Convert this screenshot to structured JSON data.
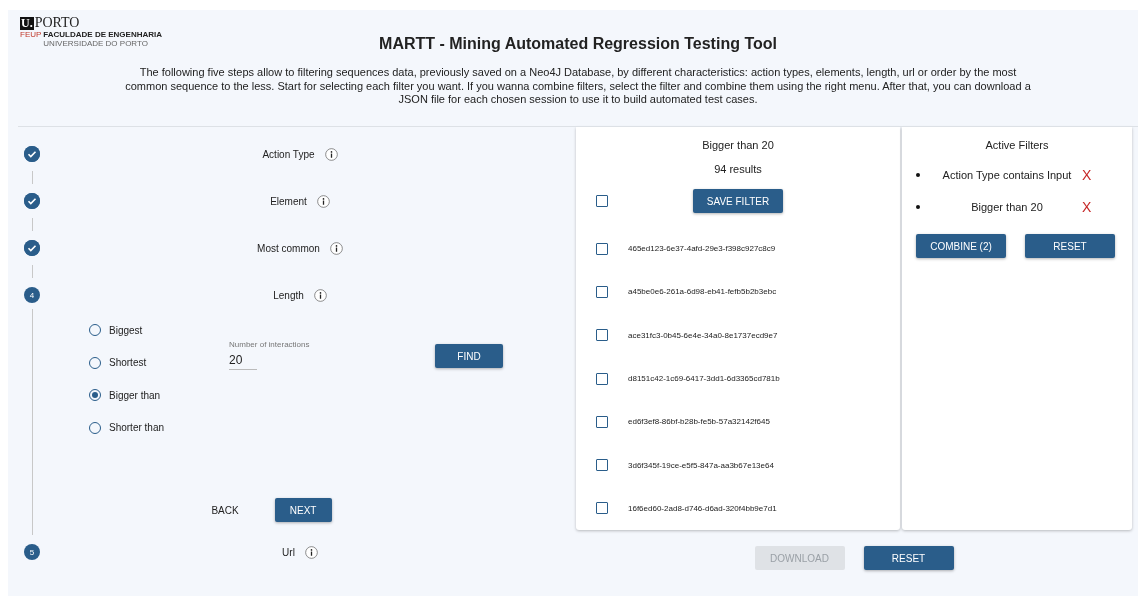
{
  "logo": {
    "mark": "U.",
    "name": "PORTO",
    "school": "FEUP",
    "line_1": "FACULDADE DE ENGENHARIA",
    "line_2": "UNIVERSIDADE DO PORTO"
  },
  "title": "MARTT - Mining Automated Regression Testing Tool",
  "description": "The following five steps allow to filtering sequences data, previously saved on a Neo4J Database, by different characteristics: action types, elements, length, url or order by the most common sequence to the less. Start for selecting each filter you want. If you wanna combine filters, select the filter and combine them using the right menu. After that, you can download a JSON file for each chosen session to use it to build automated test cases.",
  "steps": [
    {
      "label": "Action Type",
      "kind": "done",
      "expanded": false
    },
    {
      "label": "Element",
      "kind": "done",
      "expanded": false
    },
    {
      "label": "Most common",
      "kind": "done",
      "expanded": false
    },
    {
      "label": "Length",
      "kind": "current",
      "number": "4",
      "expanded": true
    },
    {
      "label": "Url",
      "kind": "current",
      "number": "5"
    }
  ],
  "length_step": {
    "options": [
      {
        "label": "Biggest",
        "selected": false
      },
      {
        "label": "Shortest",
        "selected": false
      },
      {
        "label": "Bigger than",
        "selected": true
      },
      {
        "label": "Shorter than",
        "selected": false
      }
    ],
    "field": {
      "label": "Number of interactions",
      "value": "20"
    },
    "find_button": "FIND",
    "back_button": "BACK",
    "next_button": "NEXT"
  },
  "results": {
    "title": "Bigger than 20",
    "count": "94 results",
    "select_all": {
      "checked": false
    },
    "save_button": "SAVE FILTER",
    "sessions": [
      {
        "id": "465ed123-6e37-4afd-29e3-f398c927c8c9",
        "checked": false
      },
      {
        "id": "a45be0e6-261a-6d98-eb41-fefb5b2b3ebc",
        "checked": false
      },
      {
        "id": "ace31fc3-0b45-6e4e-34a0-8e1737ecd9e7",
        "checked": false
      },
      {
        "id": "d8151c42-1c69-6417-3dd1-6d3365cd781b",
        "checked": false
      },
      {
        "id": "ed6f3ef8-86bf-b28b-fe5b-57a32142f645",
        "checked": false
      },
      {
        "id": "3d6f345f-19ce-e5f5-847a-aa3b67e13e64",
        "checked": false
      },
      {
        "id": "16f6ed60-2ad8-d746-d6ad-320f4bb9e7d1",
        "checked": false
      }
    ]
  },
  "active_filters": {
    "title": "Active Filters",
    "filters": [
      {
        "label": "Action Type contains Input",
        "remove": "X"
      },
      {
        "label": "Bigger than 20",
        "remove": "X"
      }
    ],
    "combine_button": "COMBINE (2)",
    "reset_button": "RESET"
  },
  "footer": {
    "download_button": {
      "label": "DOWNLOAD",
      "disabled": true
    },
    "reset_button": {
      "label": "RESET",
      "disabled": false
    }
  }
}
